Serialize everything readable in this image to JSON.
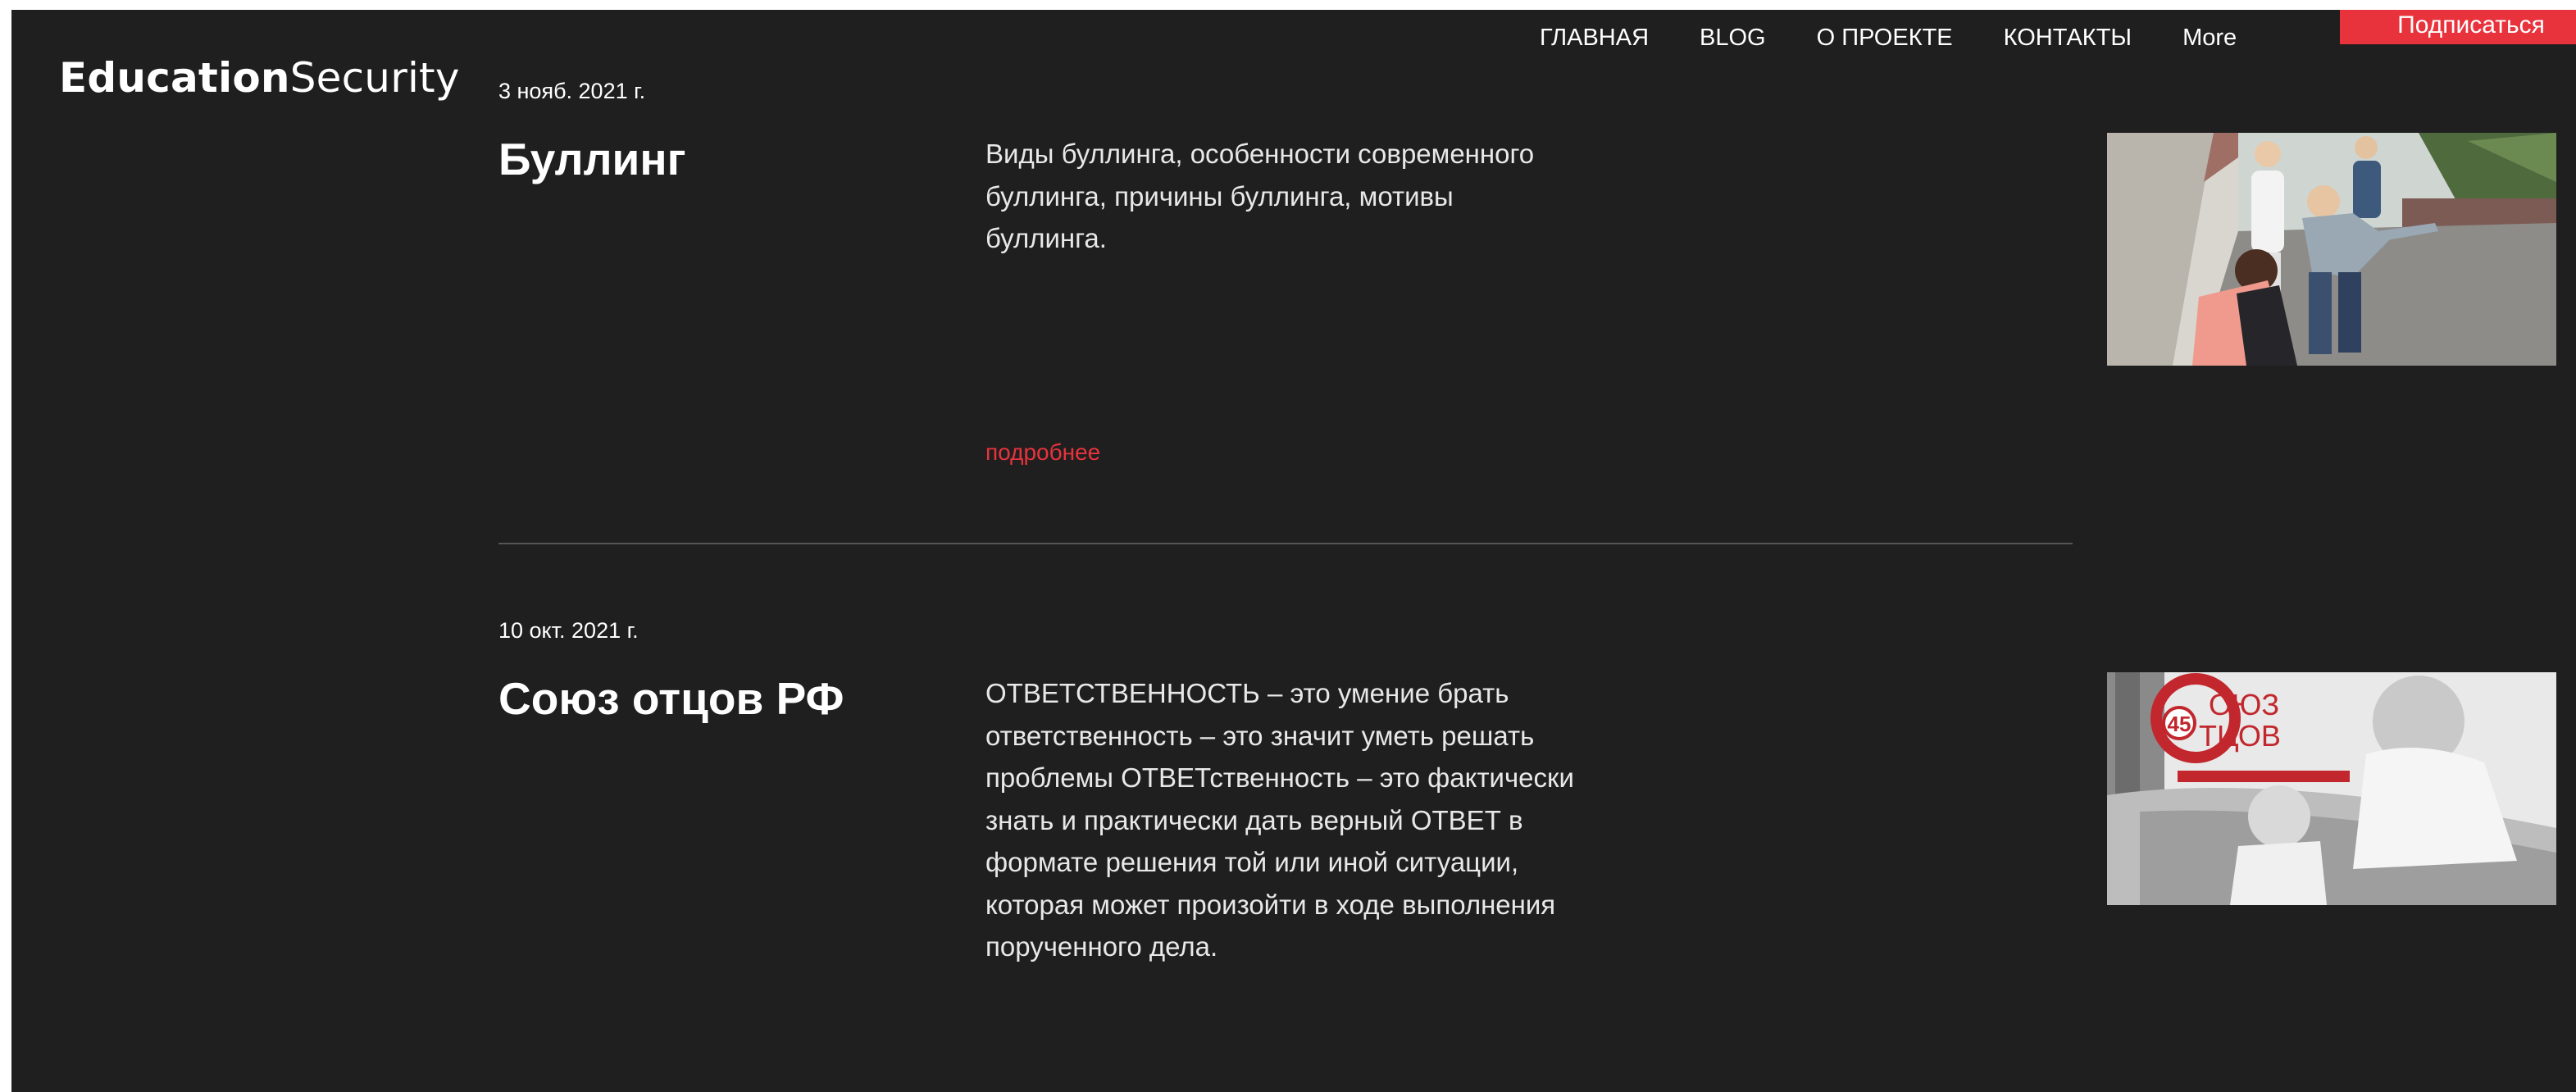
{
  "header": {
    "logo_bold": "Education",
    "logo_light": "Security",
    "nav": [
      {
        "label": "ГЛАВНАЯ"
      },
      {
        "label": "BLOG"
      },
      {
        "label": "О ПРОЕКТЕ"
      },
      {
        "label": "КОНТАКТЫ"
      },
      {
        "label": "More"
      }
    ],
    "subscribe_label": "Подписаться"
  },
  "posts": [
    {
      "date": "3 нояб. 2021 г.",
      "title": "Буллинг",
      "excerpt": "Виды буллинга, особенности современного буллинга, причины буллинга, мотивы буллинга.",
      "more_label": "подробнее"
    },
    {
      "date": "10 окт. 2021 г.",
      "title": "Союз отцов РФ",
      "excerpt": "ОТВЕТСТВЕННОСТЬ – это умение брать ответственность – это значит уметь решать проблемы ОТВЕТственность – это фактически знать и практически дать верный ОТВЕТ в формате решения той или иной ситуации, которая может произойти в ходе выполнения порученного дела.",
      "logo_badge": "45",
      "logo_line1": "ОЮЗ",
      "logo_line2": "ТЦОВ"
    }
  ],
  "colors": {
    "background": "#1f1f1f",
    "accent": "#e8333d",
    "text": "#ffffff"
  }
}
